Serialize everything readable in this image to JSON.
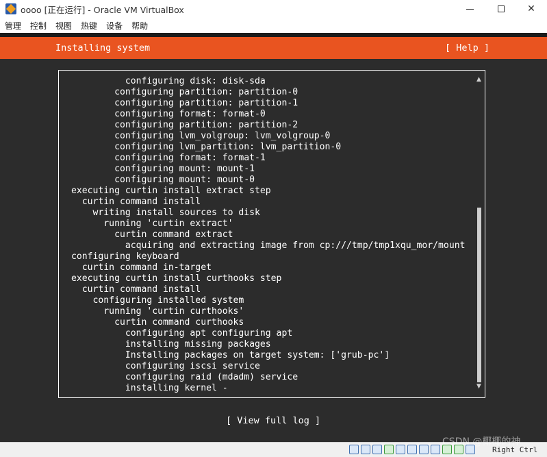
{
  "window": {
    "title": "oooo [正在运行] - Oracle VM VirtualBox"
  },
  "menu": {
    "items": [
      "管理",
      "控制",
      "视图",
      "热键",
      "设备",
      "帮助"
    ]
  },
  "installer": {
    "header_title": "Installing system",
    "help_label": "[ Help ]",
    "view_log_label": "[ View full log ]",
    "log_lines": [
      "          configuring disk: disk-sda",
      "        configuring partition: partition-0",
      "        configuring partition: partition-1",
      "        configuring format: format-0",
      "        configuring partition: partition-2",
      "        configuring lvm_volgroup: lvm_volgroup-0",
      "        configuring lvm_partition: lvm_partition-0",
      "        configuring format: format-1",
      "        configuring mount: mount-1",
      "        configuring mount: mount-0",
      "executing curtin install extract step",
      "  curtin command install",
      "    writing install sources to disk",
      "      running 'curtin extract'",
      "        curtin command extract",
      "          acquiring and extracting image from cp:///tmp/tmp1xqu_mor/mount",
      "configuring keyboard",
      "  curtin command in-target",
      "executing curtin install curthooks step",
      "  curtin command install",
      "    configuring installed system",
      "      running 'curtin curthooks'",
      "        curtin command curthooks",
      "          configuring apt configuring apt",
      "          installing missing packages",
      "          Installing packages on target system: ['grub-pc']",
      "          configuring iscsi service",
      "          configuring raid (mdadm) service",
      "          installing kernel -"
    ]
  },
  "statusbar": {
    "host_key": "Right Ctrl",
    "watermark": "CSDN @椰椰的神"
  },
  "colors": {
    "accent": "#e95420",
    "terminal_bg": "#2c2c2c"
  }
}
